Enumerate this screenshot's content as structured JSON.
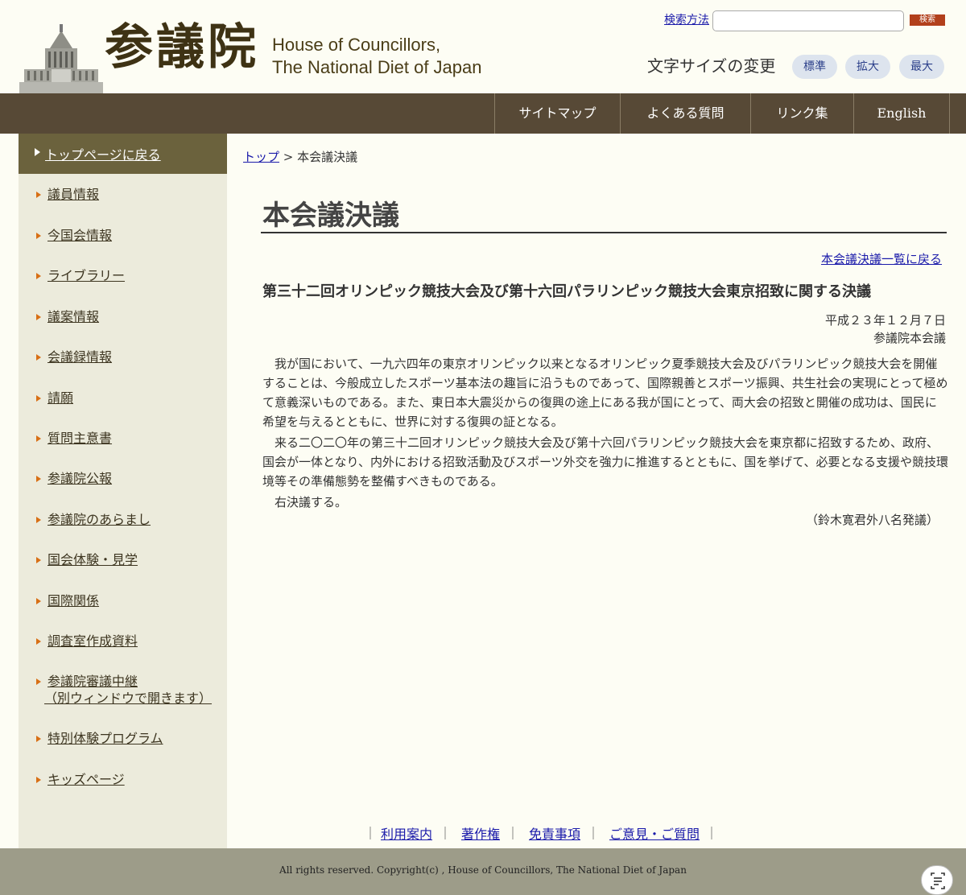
{
  "header": {
    "logo_kanji": "参議院",
    "logo_en_line1": "House of Councillors,",
    "logo_en_line2": "The National Diet of Japan",
    "search_link": "検索方法",
    "search_value": "",
    "search_button": "検索",
    "font_size_label": "文字サイズの変更",
    "size_buttons": [
      "標準",
      "拡大",
      "最大"
    ]
  },
  "nav": {
    "items": [
      "サイトマップ",
      "よくある質問",
      "リンク集",
      "English"
    ]
  },
  "sidebar": {
    "top_item": "トップページに戻る",
    "items": [
      "議員情報",
      "今国会情報",
      "ライブラリー",
      "議案情報",
      "会議録情報",
      "請願",
      "質問主意書",
      "参議院公報",
      "参議院のあらまし",
      "国会体験・見学",
      "国際関係",
      "調査室作成資料",
      "参議院審議中継",
      "（別ウィンドウで開きます）",
      "特別体験プログラム",
      "キッズページ"
    ]
  },
  "main": {
    "breadcrumb_link": "トップ",
    "breadcrumb_sep": " > ",
    "breadcrumb_current": "本会議決議",
    "page_title": "本会議決議",
    "back_link": "本会議決議一覧に戻る",
    "resolution_title": "第三十二回オリンピック競技大会及び第十六回パラリンピック競技大会東京招致に関する決議",
    "date": "平成２３年１２月７日",
    "body": "参議院本会議",
    "paragraphs": [
      "我が国において、一九六四年の東京オリンピック以来となるオリンピック夏季競技大会及びパラリンピック競技大会を開催することは、今般成立したスポーツ基本法の趣旨に沿うものであって、国際親善とスポーツ振興、共生社会の実現にとって極めて意義深いものである。また、東日本大震災からの復興の途上にある我が国にとって、両大会の招致と開催の成功は、国民に希望を与えるとともに、世界に対する復興の証となる。",
      "来る二〇二〇年の第三十二回オリンピック競技大会及び第十六回パラリンピック競技大会を東京都に招致するため、政府、国会が一体となり、内外における招致活動及びスポーツ外交を強力に推進するとともに、国を挙げて、必要となる支援や競技環境等その準備態勢を整備すべきものである。",
      "右決議する。"
    ],
    "proposer": "（鈴木寛君外八名発議）"
  },
  "footer": {
    "links": [
      "利用案内",
      "著作権",
      "免責事項",
      "ご意見・ご質問"
    ],
    "separator": "｜",
    "copyright": "All rights reserved. Copyright(c) , House of Councillors, The National Diet of Japan"
  },
  "colors": {
    "nav_bg": "#574936",
    "sidebar_top_bg": "#6b623d",
    "sidebar_bg": "#ecebdc",
    "page_bg": "#fdfdf4",
    "link": "#1a1aaa",
    "arrow": "#d86f15",
    "search_btn": "#b2401c",
    "footer_bg": "#9d9c89"
  }
}
